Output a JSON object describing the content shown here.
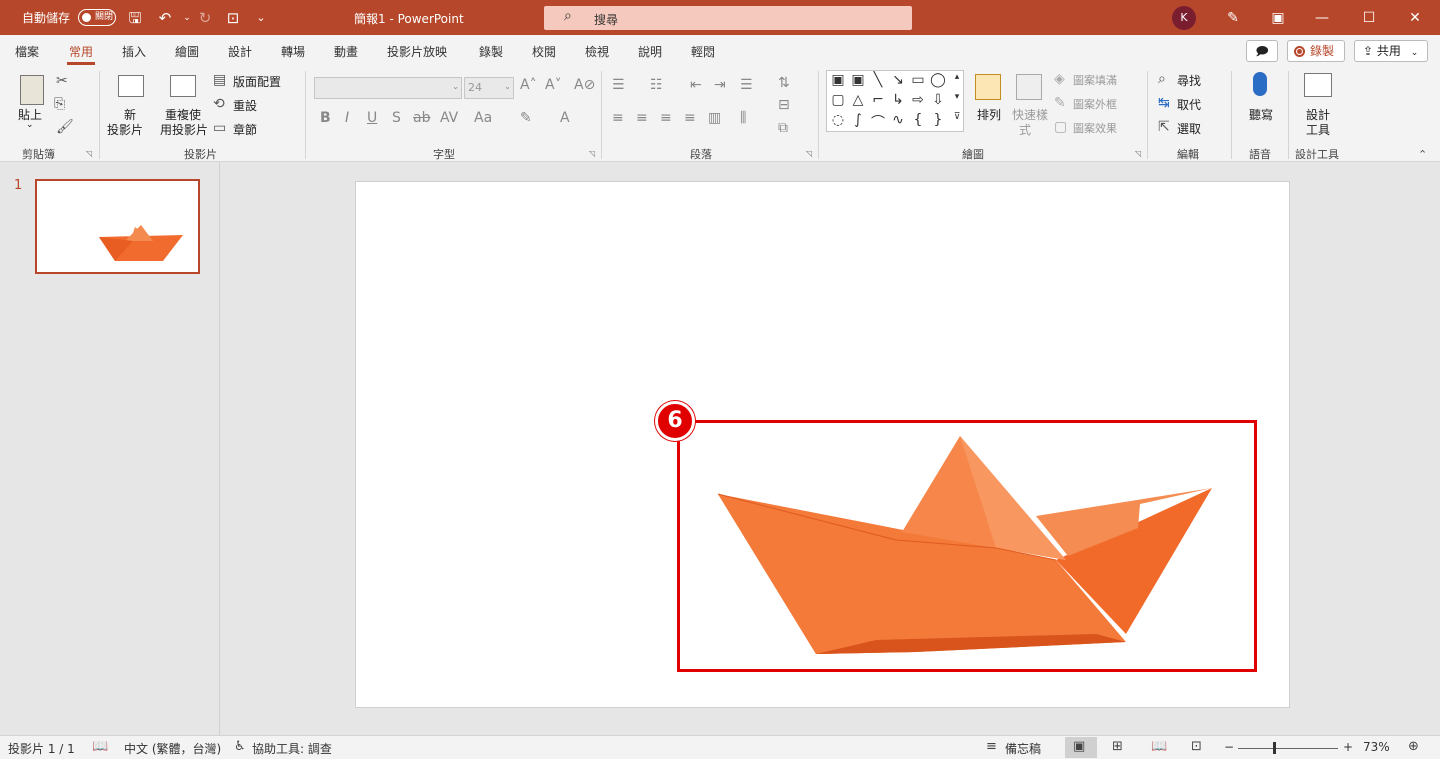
{
  "titlebar": {
    "autosave_label": "自動儲存",
    "autosave_state": "關閉",
    "doc_title": "簡報1 - PowerPoint",
    "search_placeholder": "搜尋",
    "user_initial": "K"
  },
  "menu": {
    "tabs": [
      "檔案",
      "常用",
      "插入",
      "繪圖",
      "設計",
      "轉場",
      "動畫",
      "投影片放映",
      "錄製",
      "校閱",
      "檢視",
      "說明",
      "輕悶"
    ],
    "active_tab": "常用",
    "record_label": "錄製",
    "share_label": "共用"
  },
  "ribbon": {
    "clipboard": {
      "paste": "貼上",
      "group": "剪貼簿"
    },
    "slides": {
      "new_slide_line1": "新",
      "new_slide_line2": "投影片",
      "reuse_line1": "重複使",
      "reuse_line2": "用投影片",
      "layout": "版面配置",
      "reset": "重設",
      "section": "章節",
      "group": "投影片"
    },
    "font": {
      "size": "24",
      "group": "字型"
    },
    "paragraph": {
      "group": "段落"
    },
    "drawing": {
      "arrange": "排列",
      "quick_styles_line1": "快速樣",
      "quick_styles_line2": "式",
      "shape_fill": "圖案填滿",
      "shape_outline": "圖案外框",
      "shape_effects": "圖案效果",
      "group": "繪圖"
    },
    "editing": {
      "find": "尋找",
      "replace": "取代",
      "select": "選取",
      "group": "編輯"
    },
    "voice": {
      "dictate": "聽寫",
      "group": "語音"
    },
    "designer": {
      "line1": "設計",
      "line2": "工具",
      "group": "設計工具"
    }
  },
  "thumbnails": {
    "slide_number": "1"
  },
  "callout": {
    "number": "6"
  },
  "colors": {
    "accent": "#b7472a",
    "highlight": "#e00000",
    "boat": "#f26b2e"
  },
  "statusbar": {
    "slide_counter": "投影片 1 / 1",
    "language": "中文 (繁體，台灣)",
    "accessibility": "協助工具: 調查",
    "notes": "備忘稿",
    "zoom_percent": "73%",
    "zoom_minus": "−",
    "zoom_plus": "+"
  }
}
